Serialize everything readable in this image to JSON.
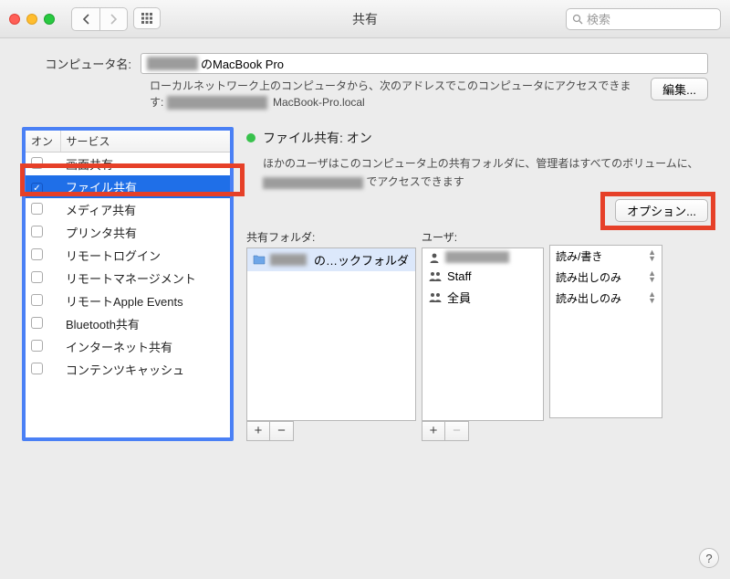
{
  "titlebar": {
    "title": "共有",
    "search_placeholder": "検索"
  },
  "computer_name": {
    "label": "コンピュータ名:",
    "value_suffix": "のMacBook Pro",
    "subtext_line1": "ローカルネットワーク上のコンピュータから、次のアドレスでこのコンピュータにアクセスできます: ",
    "subtext_line2_suffix": "MacBook-Pro.local",
    "edit_btn": "編集..."
  },
  "services": {
    "col_on": "オン",
    "col_service": "サービス",
    "items": [
      {
        "on": false,
        "label": "画面共有"
      },
      {
        "on": true,
        "label": "ファイル共有",
        "selected": true
      },
      {
        "on": false,
        "label": "メディア共有"
      },
      {
        "on": false,
        "label": "プリンタ共有"
      },
      {
        "on": false,
        "label": "リモートログイン"
      },
      {
        "on": false,
        "label": "リモートマネージメント"
      },
      {
        "on": false,
        "label": "リモートApple Events"
      },
      {
        "on": false,
        "label": "Bluetooth共有"
      },
      {
        "on": false,
        "label": "インターネット共有"
      },
      {
        "on": false,
        "label": "コンテンツキャッシュ"
      }
    ]
  },
  "right": {
    "status": "ファイル共有: オン",
    "desc_pre": "ほかのユーザはこのコンピュータ上の共有フォルダに、管理者はすべてのボリュームに、",
    "desc_post": "でアクセスできます",
    "options_btn": "オプション...",
    "folders_label": "共有フォルダ:",
    "users_label": "ユーザ:",
    "folders": [
      {
        "label_suffix": "の…ックフォルダ"
      }
    ],
    "users": [
      {
        "label": "",
        "redacted": true
      },
      {
        "label": "Staff"
      },
      {
        "label": "全員"
      }
    ],
    "perms": [
      "読み/書き",
      "読み出しのみ",
      "読み出しのみ"
    ]
  }
}
